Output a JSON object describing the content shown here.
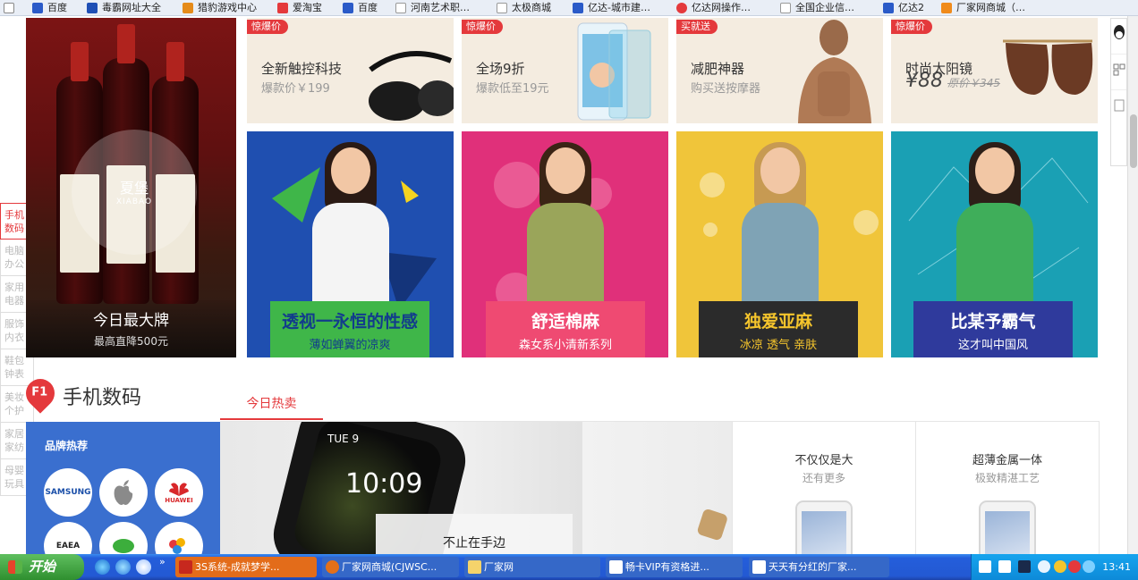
{
  "bookmarks": [
    {
      "label": "百度",
      "color": "#2a5ac8"
    },
    {
      "label": "毒霸网址大全",
      "color": "#1f4fb5"
    },
    {
      "label": "猎豹游戏中心",
      "color": "#e58b1a"
    },
    {
      "label": "爱淘宝",
      "color": "#e4393c"
    },
    {
      "label": "百度",
      "color": "#2a5ac8"
    },
    {
      "label": "河南艺术职…",
      "color": "#ffffff"
    },
    {
      "label": "太极商城",
      "color": "#ffffff"
    },
    {
      "label": "亿达-城市建…",
      "color": "#2a5ac8"
    },
    {
      "label": "亿达网操作…",
      "color": "#e4393c"
    },
    {
      "label": "全国企业信…",
      "color": "#ffffff"
    },
    {
      "label": "亿达2",
      "color": "#2a5ac8"
    },
    {
      "label": "厂家网商城（…",
      "color": "#f08b1c"
    }
  ],
  "floor_nav": [
    {
      "label": "手机数码",
      "active": true
    },
    {
      "label": "电脑办公",
      "active": false
    },
    {
      "label": "家用电器",
      "active": false
    },
    {
      "label": "服饰内衣",
      "active": false
    },
    {
      "label": "鞋包钟表",
      "active": false
    },
    {
      "label": "美妆个护",
      "active": false
    },
    {
      "label": "家居家纺",
      "active": false
    },
    {
      "label": "母婴玩具",
      "active": false
    }
  ],
  "wine_banner": {
    "brand_cn": "夏堡",
    "brand_en": "XIABAO",
    "title": "今日最大牌",
    "subtitle": "最高直降500元"
  },
  "promos": [
    {
      "badge": "惊爆价",
      "title": "全新触控科技",
      "sub": "爆款价￥199"
    },
    {
      "badge": "惊爆价",
      "title": "全场9折",
      "sub": "爆款低至19元"
    },
    {
      "badge": "买就送",
      "title": "减肥神器",
      "sub": "购买送按摩器"
    },
    {
      "badge": "惊爆价",
      "title": "时尚太阳镜",
      "price": "¥88",
      "old_price": "原价￥345"
    }
  ],
  "fashion": [
    {
      "title": "透视一永恒的性感",
      "sub": "薄如蝉翼的凉爽",
      "bg": "#1f4fb0",
      "cap_bg": "#3fb649",
      "title_color": "#123c8c",
      "sub_color": "#123c8c"
    },
    {
      "title": "舒适棉麻",
      "sub": "森女系小清新系列",
      "bg": "#e0307a",
      "cap_bg": "#ef4a72",
      "title_color": "#ffffff",
      "sub_color": "#ffffff"
    },
    {
      "title": "独爱亚麻",
      "sub": "冰凉 透气 亲肤",
      "bg": "#f0c53a",
      "cap_bg": "#2b2b2b",
      "title_color": "#f5c52c",
      "sub_color": "#f5c52c"
    },
    {
      "title": "比某予霸气",
      "sub": "这才叫中国风",
      "bg": "#1aa0b4",
      "cap_bg": "#2f3a9c",
      "title_color": "#ffffff",
      "sub_color": "#ffffff"
    }
  ],
  "floor": {
    "badge": "F1",
    "title": "手机数码",
    "tab": "今日热卖"
  },
  "brands": {
    "title": "品牌热荐",
    "logos": [
      {
        "name": "SAMSUNG",
        "color": "#1b4fa8"
      },
      {
        "name": "",
        "color": "#8a8a8a"
      },
      {
        "name": "HUAWEI",
        "color": "#d8272a"
      },
      {
        "name": "EAEA",
        "color": "#222222"
      },
      {
        "name": "",
        "color": "#3cae3c"
      },
      {
        "name": "",
        "color": "#e4393c"
      }
    ]
  },
  "watch_banner": {
    "date": "TUE 9",
    "time": "10:09",
    "caption": "不止在手边"
  },
  "phones": [
    {
      "title": "不仅仅是大",
      "sub": "还有更多"
    },
    {
      "title": "超薄金属一体",
      "sub": "极致精湛工艺"
    }
  ],
  "taskbar": {
    "start": "开始",
    "tasks": [
      {
        "label": "3S系统-成就梦学...",
        "color": "#e06a1c",
        "active": true
      },
      {
        "label": "厂家网商城(CJWSC...",
        "color": "#3568c8",
        "active": false
      },
      {
        "label": "厂家网",
        "color": "#3568c8",
        "active": false
      },
      {
        "label": "畅卡VIP有资格进...",
        "color": "#3568c8",
        "active": false
      },
      {
        "label": "天天有分红的厂家...",
        "color": "#3568c8",
        "active": false
      }
    ],
    "clock": "13:41"
  }
}
